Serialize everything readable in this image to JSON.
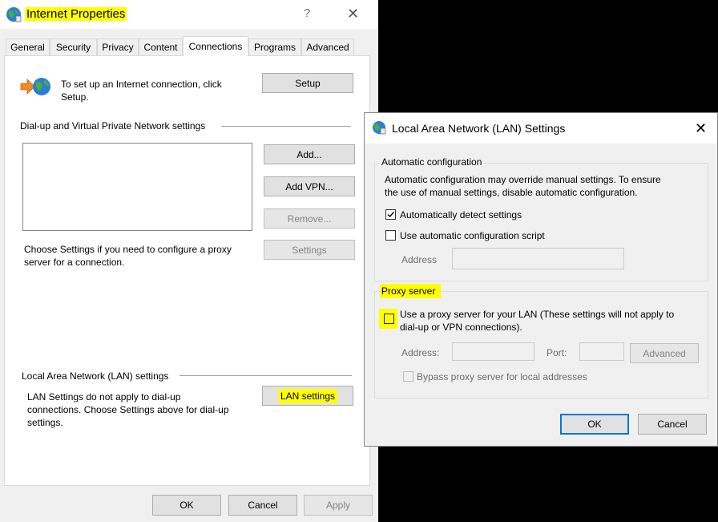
{
  "main": {
    "title": "Internet Properties",
    "help": "?",
    "close": "✕",
    "tabs": [
      {
        "label": "General"
      },
      {
        "label": "Security"
      },
      {
        "label": "Privacy"
      },
      {
        "label": "Content"
      },
      {
        "label": "Connections"
      },
      {
        "label": "Programs"
      },
      {
        "label": "Advanced"
      }
    ],
    "setup_text_1": "To set up an Internet connection, click",
    "setup_text_2": "Setup.",
    "setup_button": "Setup",
    "dialup_heading": "Dial-up and Virtual Private Network settings",
    "add_button": "Add...",
    "add_vpn_button": "Add VPN...",
    "remove_button": "Remove...",
    "settings_button": "Settings",
    "proxy_text_1": "Choose Settings if you need to configure a proxy",
    "proxy_text_2": "server for a connection.",
    "lan_heading": "Local Area Network (LAN) settings",
    "lan_text_1": "LAN Settings do not apply to dial-up",
    "lan_text_2": "connections. Choose Settings above for dial-up",
    "lan_text_3": "settings.",
    "lan_button": "LAN settings",
    "ok_button": "OK",
    "cancel_button": "Cancel",
    "apply_button": "Apply"
  },
  "lan_dialog": {
    "title": "Local Area Network (LAN) Settings",
    "close": "✕",
    "auto_group_label": "Automatic configuration",
    "auto_desc_1": "Automatic configuration may override manual settings.  To ensure",
    "auto_desc_2": "the use of manual settings, disable automatic configuration.",
    "auto_detect_label": "Automatically detect settings",
    "auto_detect_checked": true,
    "auto_script_label": "Use automatic configuration script",
    "auto_script_checked": false,
    "address_label": "Address",
    "address_value": "",
    "proxy_group_label": "Proxy server",
    "use_proxy_label_1": "Use a proxy server for your LAN (These settings will not apply to",
    "use_proxy_label_2": "dial-up or VPN connections).",
    "use_proxy_checked": false,
    "proxy_address_label": "Address:",
    "proxy_address_value": "",
    "port_label": "Port:",
    "port_value": "",
    "advanced_button": "Advanced",
    "bypass_label": "Bypass proxy server for local addresses",
    "bypass_checked": false,
    "ok_button": "OK",
    "cancel_button": "Cancel"
  },
  "colors": {
    "highlight": "#ffff00",
    "accent": "#0078d7",
    "window_bg": "#f0f0f0"
  }
}
